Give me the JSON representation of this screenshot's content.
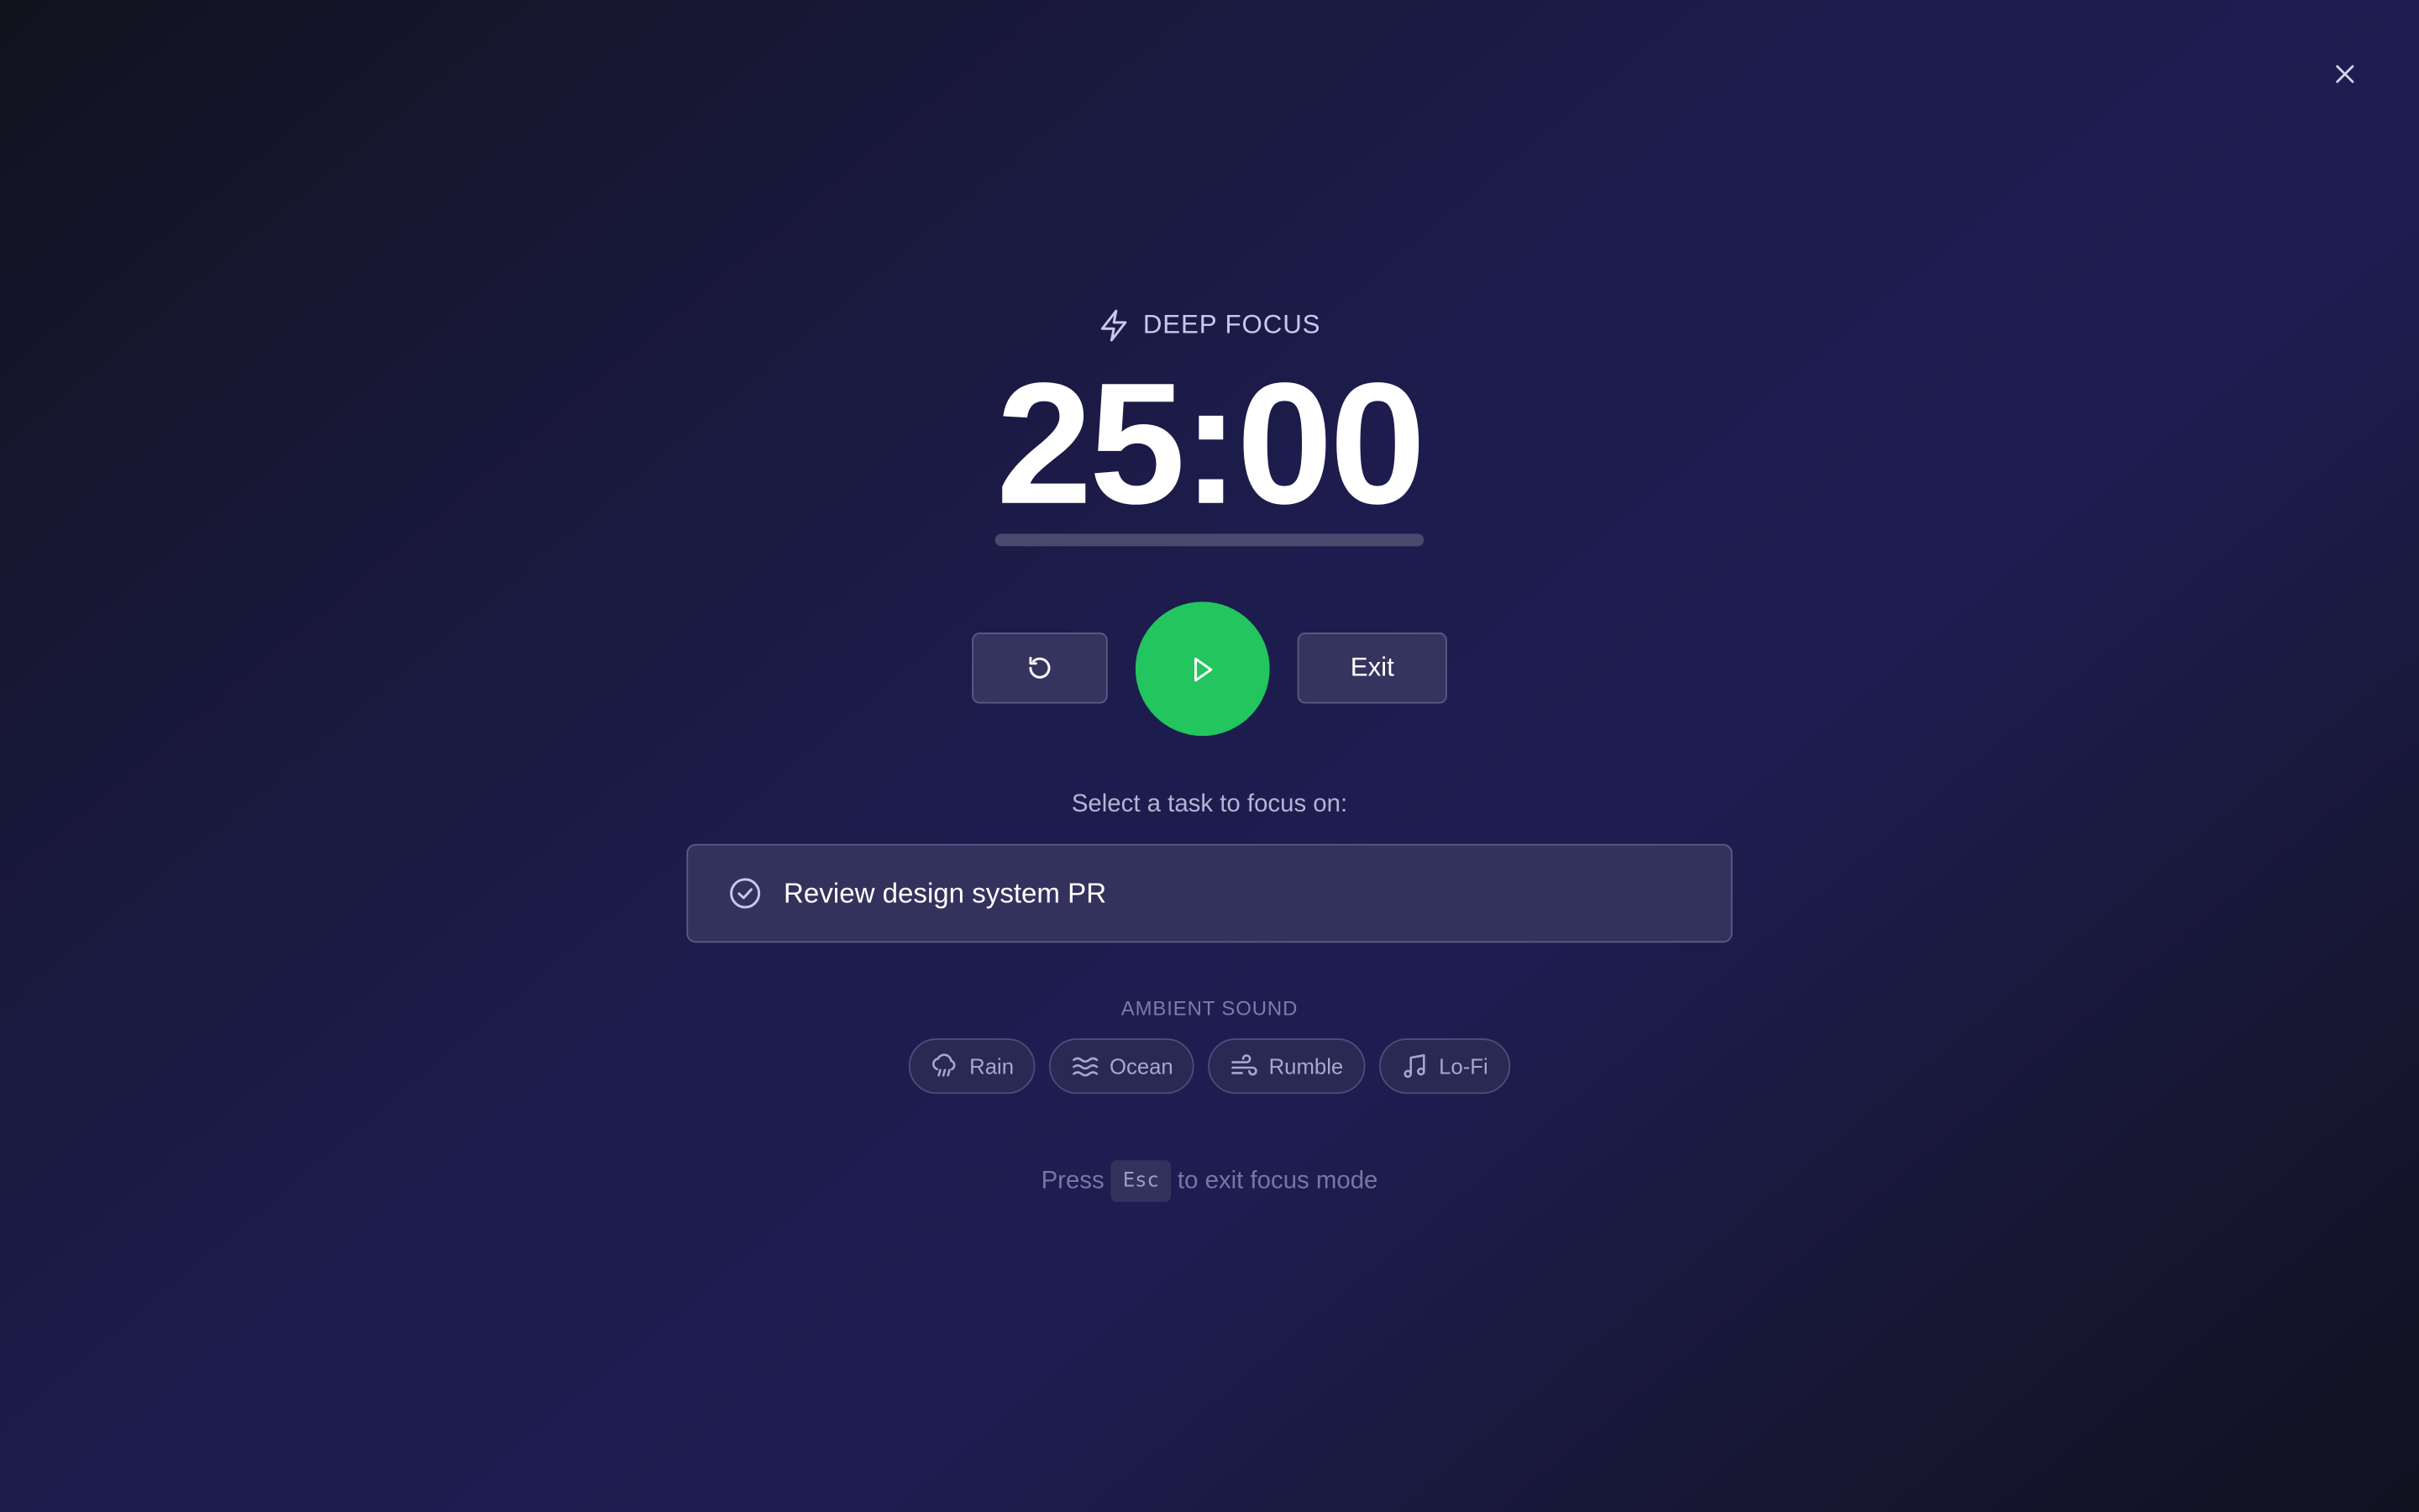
{
  "mode": {
    "label": "DEEP FOCUS",
    "icon": "lightning-icon"
  },
  "timer": {
    "display": "25:00",
    "progress": 0
  },
  "controls": {
    "reset_icon": "reset-icon",
    "play_icon": "play-icon",
    "exit_label": "Exit"
  },
  "task": {
    "prompt": "Select a task to focus on:",
    "selected": "Review design system PR",
    "icon": "check-circle-icon"
  },
  "ambient": {
    "heading": "AMBIENT SOUND",
    "sounds": [
      {
        "label": "Rain",
        "icon": "rain-cloud-icon"
      },
      {
        "label": "Ocean",
        "icon": "waves-icon"
      },
      {
        "label": "Rumble",
        "icon": "wind-icon"
      },
      {
        "label": "Lo-Fi",
        "icon": "music-note-icon"
      }
    ]
  },
  "hint": {
    "prefix": "Press",
    "key": "Esc",
    "suffix": "to exit focus mode"
  },
  "colors": {
    "accent": "#22c55e",
    "background_mid": "#1e1d52"
  }
}
